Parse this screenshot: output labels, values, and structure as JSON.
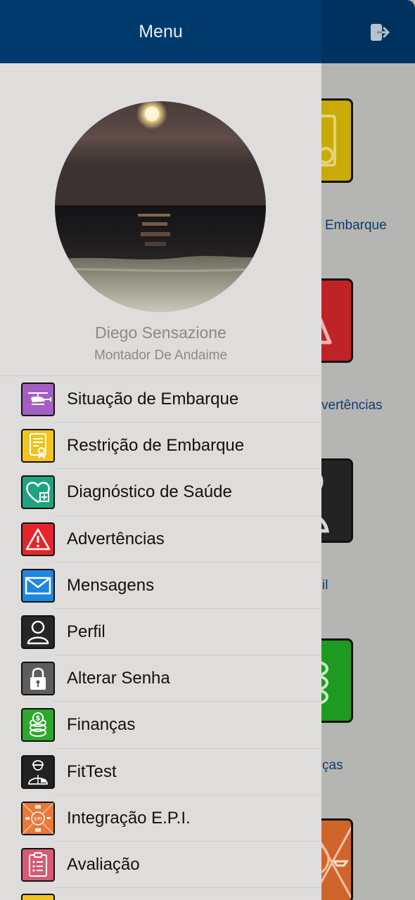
{
  "drawer": {
    "title": "Menu",
    "profile": {
      "name": "Diego Sensazione",
      "role": "Montador De Andaime"
    },
    "items": [
      {
        "label": "Situação de Embarque",
        "icon": "helicopter-icon",
        "color": "#a35fc3"
      },
      {
        "label": "Restrição de Embarque",
        "icon": "certificate-icon",
        "color": "#f0c41b"
      },
      {
        "label": "Diagnóstico de Saúde",
        "icon": "heart-plus-icon",
        "color": "#1fa37f"
      },
      {
        "label": "Advertências",
        "icon": "warning-icon",
        "color": "#e4262c"
      },
      {
        "label": "Mensagens",
        "icon": "envelope-icon",
        "color": "#1f86e0"
      },
      {
        "label": "Perfil",
        "icon": "user-icon",
        "color": "#262626"
      },
      {
        "label": "Alterar Senha",
        "icon": "lock-icon",
        "color": "#5d5d5d"
      },
      {
        "label": "Finanças",
        "icon": "coins-icon",
        "color": "#2da82c"
      },
      {
        "label": "FitTest",
        "icon": "worker-icon",
        "color": "#222222"
      },
      {
        "label": "Integração E.P.I.",
        "icon": "epi-icon",
        "color": "#e8793b"
      },
      {
        "label": "Avaliação",
        "icon": "clipboard-icon",
        "color": "#d95a73"
      }
    ]
  },
  "background": {
    "labels": [
      "Embarque",
      "vertências",
      "il",
      "ças"
    ],
    "tile_colors": [
      "#c8ab06",
      "#c02327",
      "#232323",
      "#1f9a20",
      "#d0652b"
    ]
  }
}
